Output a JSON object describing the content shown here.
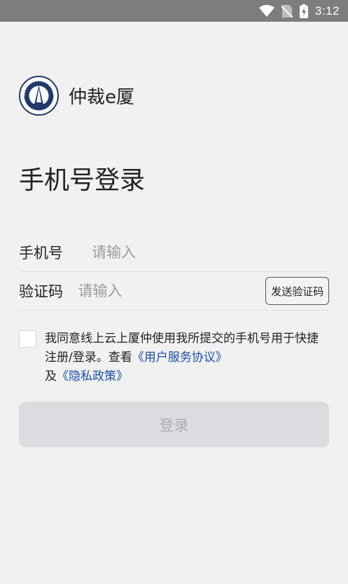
{
  "status_bar": {
    "time": "3:12",
    "icons": [
      "wifi-icon",
      "no-sim-icon",
      "battery-charging-icon"
    ]
  },
  "brand": {
    "name": "仲裁e厦",
    "logo_icon": "arbitration-commission-seal-icon"
  },
  "page_title": "手机号登录",
  "form": {
    "phone": {
      "label": "手机号",
      "placeholder": "请输入",
      "value": ""
    },
    "code": {
      "label": "验证码",
      "placeholder": "请输入",
      "value": "",
      "send_button": "发送验证码"
    }
  },
  "agreement": {
    "checked": false,
    "text_1": "我同意线上云上厦仲使用我所提交的手机号用于快捷注册/登录。查看",
    "link_1": "《用户服务协议》",
    "text_2": "及",
    "link_2": "《隐私政策》"
  },
  "login_button": "登录",
  "colors": {
    "background": "#f1f1f1",
    "status_bar": "#7d7d7d",
    "link": "#1c4fa8",
    "button_disabled_bg": "#dcdce0",
    "button_disabled_text": "#a9abb6",
    "logo_navy": "#1f3a6b"
  }
}
